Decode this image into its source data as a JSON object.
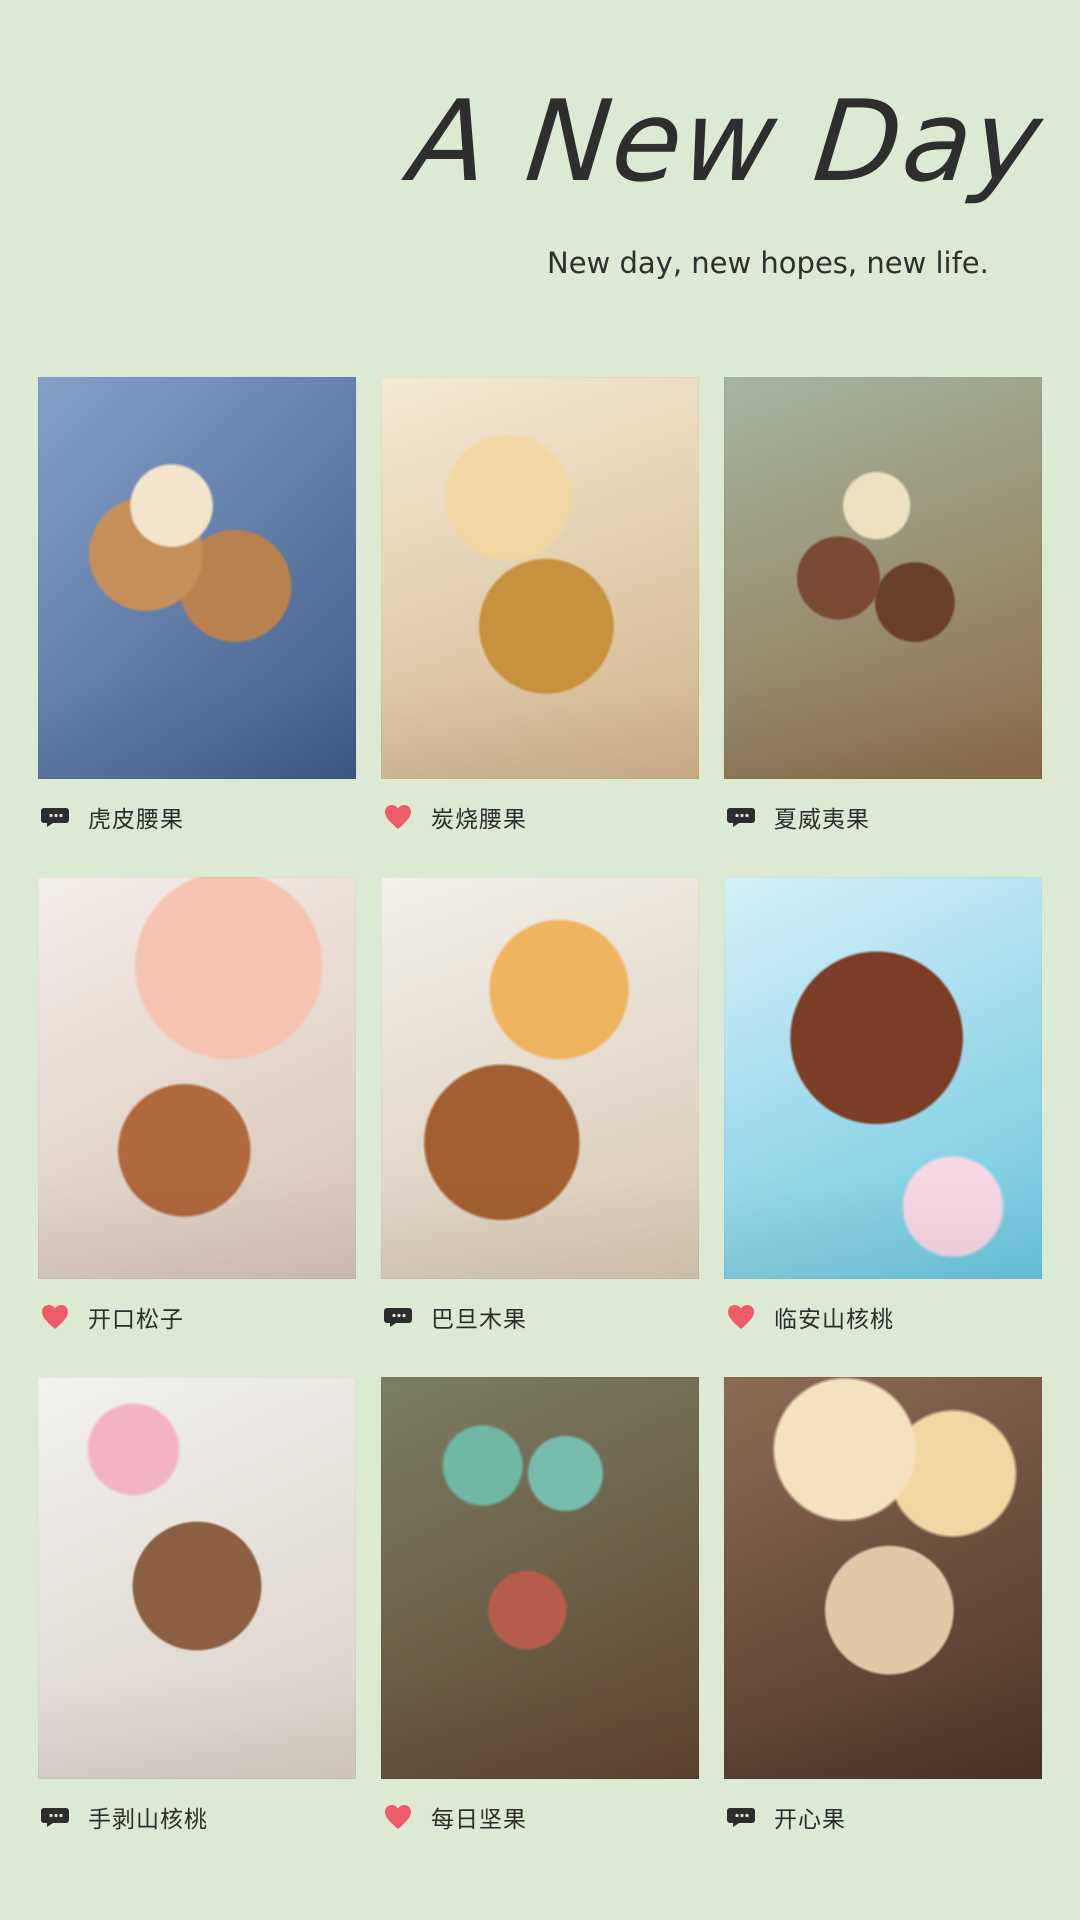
{
  "header": {
    "title": "A New Day",
    "subtitle": "New day, new hopes, new life."
  },
  "items": [
    {
      "label": "虎皮腰果",
      "icon": "comment-icon"
    },
    {
      "label": "炭烧腰果",
      "icon": "heart-icon",
      "icon_color": "#ef5b6b"
    },
    {
      "label": "夏威夷果",
      "icon": "comment-icon"
    },
    {
      "label": "开口松子",
      "icon": "heart-icon",
      "icon_color": "#ef5b6b"
    },
    {
      "label": "巴旦木果",
      "icon": "comment-icon"
    },
    {
      "label": "临安山核桃",
      "icon": "heart-icon",
      "icon_color": "#ef5b6b"
    },
    {
      "label": "手剥山核桃",
      "icon": "comment-icon"
    },
    {
      "label": "每日坚果",
      "icon": "heart-icon",
      "icon_color": "#ef5b6b"
    },
    {
      "label": "开心果",
      "icon": "comment-icon"
    }
  ]
}
